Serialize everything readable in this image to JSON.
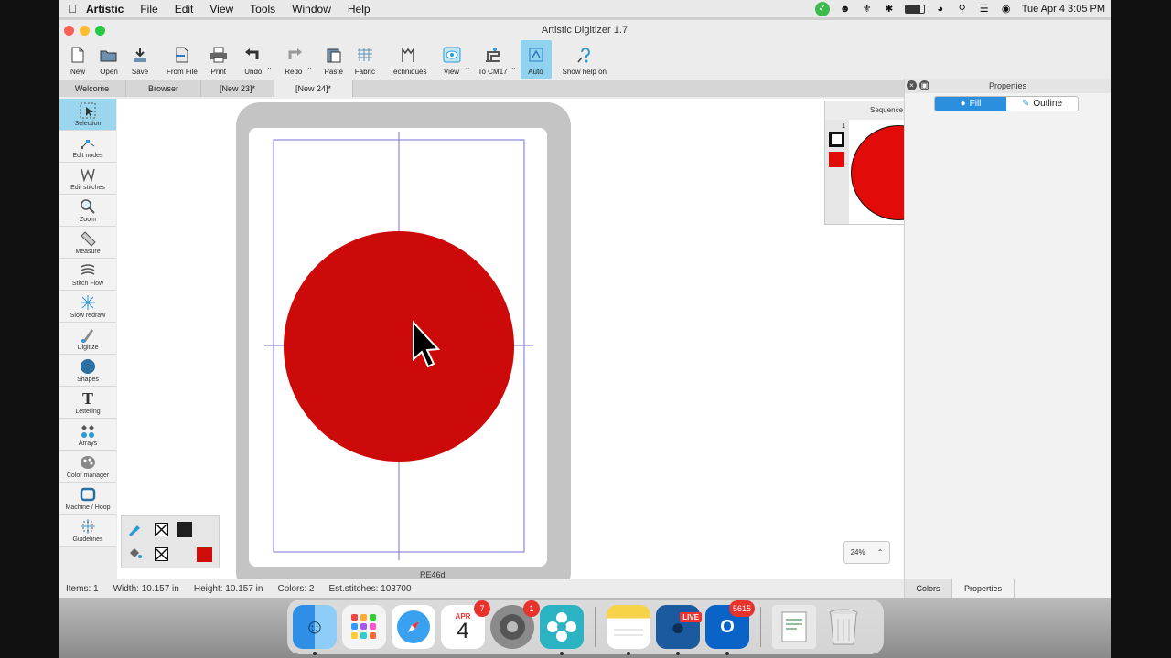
{
  "menubar": {
    "app": "Artistic",
    "items": [
      "File",
      "Edit",
      "View",
      "Tools",
      "Window",
      "Help"
    ],
    "datetime": "Tue Apr 4  3:05 PM"
  },
  "window": {
    "title": "Artistic Digitizer 1.7"
  },
  "toolbar": {
    "buttons": [
      {
        "label": "New",
        "icon": "new-doc-icon"
      },
      {
        "label": "Open",
        "icon": "open-folder-icon"
      },
      {
        "label": "Save",
        "icon": "save-icon"
      },
      {
        "label": "From File",
        "icon": "from-file-icon"
      },
      {
        "label": "Print",
        "icon": "print-icon"
      },
      {
        "label": "Undo",
        "icon": "undo-icon"
      },
      {
        "label": "Redo",
        "icon": "redo-icon"
      },
      {
        "label": "Paste",
        "icon": "paste-icon"
      },
      {
        "label": "Fabric",
        "icon": "fabric-icon"
      },
      {
        "label": "Techniques",
        "icon": "techniques-icon"
      },
      {
        "label": "View",
        "icon": "view-icon"
      },
      {
        "label": "To CM17",
        "icon": "machine-icon"
      },
      {
        "label": "Auto",
        "icon": "auto-icon"
      },
      {
        "label": "Show help on",
        "icon": "help-icon"
      }
    ]
  },
  "tabs": [
    "Welcome",
    "Browser",
    "[New 23]*",
    "[New 24]*"
  ],
  "tools": [
    {
      "label": "Selection",
      "icon": "selection-icon"
    },
    {
      "label": "Edit nodes",
      "icon": "edit-nodes-icon"
    },
    {
      "label": "Edit stitches",
      "icon": "edit-stitches-icon"
    },
    {
      "label": "Zoom",
      "icon": "zoom-icon"
    },
    {
      "label": "Measure",
      "icon": "measure-icon"
    },
    {
      "label": "Stitch Flow",
      "icon": "stitch-flow-icon"
    },
    {
      "label": "Slow redraw",
      "icon": "slow-redraw-icon"
    },
    {
      "label": "Digitize",
      "icon": "digitize-icon"
    },
    {
      "label": "Shapes",
      "icon": "shapes-icon"
    },
    {
      "label": "Lettering",
      "icon": "lettering-icon"
    },
    {
      "label": "Arrays",
      "icon": "arrays-icon"
    },
    {
      "label": "Color manager",
      "icon": "color-manager-icon"
    },
    {
      "label": "Machine / Hoop",
      "icon": "hoop-icon"
    },
    {
      "label": "Guidelines",
      "icon": "guidelines-icon"
    }
  ],
  "sequence": {
    "title": "Sequence",
    "index": "1",
    "fill_color": "#e30a0a"
  },
  "canvas": {
    "design_color": "#cc0a0a",
    "hoop_name": "RE46d",
    "zoom": "24%"
  },
  "status": {
    "items": "Items: 1",
    "width": "Width: 10.157 in",
    "height": "Height: 10.157 in",
    "colors": "Colors: 2",
    "stitches": "Est.stitches: 103700"
  },
  "properties": {
    "title": "Properties",
    "fill_label": "Fill",
    "outline_label": "Outline",
    "bottom_tabs": [
      "Colors",
      "Properties"
    ]
  },
  "dock": {
    "calendar_month": "APR",
    "calendar_day": "4",
    "calendar_badge": "7",
    "settings_badge": "1",
    "outlook_badge": "5615",
    "live_label": "LIVE"
  }
}
